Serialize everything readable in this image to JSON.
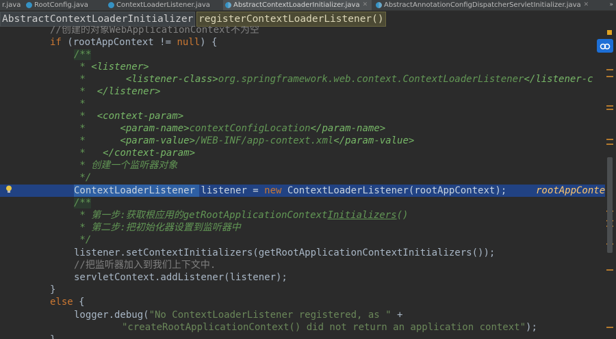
{
  "tabs": [
    {
      "label": "r.java",
      "icon": "none",
      "active": false
    },
    {
      "label": "RootConfig.java",
      "icon": "java-class-icon",
      "active": false
    },
    {
      "label": "ContextLoaderListener.java",
      "icon": "java-class-icon",
      "active": false
    },
    {
      "label": "AbstractContextLoaderInitializer.java",
      "icon": "abstract-class-icon",
      "active": true
    },
    {
      "label": "AbstractAnnotationConfigDispatcherServletInitializer.java",
      "icon": "abstract-class-icon",
      "active": false
    }
  ],
  "tab_menu_label": "»",
  "breadcrumb": {
    "class_name": "AbstractContextLoaderInitializer",
    "method_name": "registerContextLoaderListener()"
  },
  "code": {
    "l0": "//创建的对象WebApplicationContext不为空",
    "l1_kw": "if",
    "l1_a": " (rootAppContext != ",
    "l1_null": "null",
    "l1_b": ") {",
    "l2": "/**",
    "l3_star": " * ",
    "l3_tag": "<listener>",
    "l4_star": " *       ",
    "l4_open": "<listener-class>",
    "l4_val": "org.springframework.web.context.ContextLoaderListener",
    "l4_close": "</listener-c",
    "l5_star": " *  ",
    "l5_tag": "</listener>",
    "l6": " *",
    "l7_star": " *  ",
    "l7_tag": "<context-param>",
    "l8_star": " *      ",
    "l8_open": "<param-name>",
    "l8_val": "contextConfigLocation",
    "l8_close": "</param-name>",
    "l9_star": " *      ",
    "l9_open": "<param-value>",
    "l9_val": "/WEB-INF/app-context.xml",
    "l9_close": "</param-value>",
    "l10_star": " *   ",
    "l10_tag": "</context-param>",
    "l11": " * 创建一个监听器对象",
    "l12": " */",
    "l13_type": "ContextLoaderListener",
    "l13_a": " listener = ",
    "l13_new": "new",
    "l13_b": " ContextLoaderListener(rootAppContext);",
    "l13_hint": "rootAppContex",
    "l14": "/**",
    "l15_a": " * 第一步:获取根应用的getRootApplicationContext",
    "l15_b": "Initializers",
    "l15_c": "()",
    "l16": " * 第二步:把初始化器设置到监听器中",
    "l17": " */",
    "l18": "listener.setContextInitializers(getRootApplicationContextInitializers());",
    "l19": "//把监听器加入到我们上下文中.",
    "l20": "servletContext.addListener(listener);",
    "l21": "}",
    "l22_kw": "else",
    "l22_b": " {",
    "l23_a": "logger.debug(",
    "l23_str": "\"No ContextLoaderListener registered, as \"",
    "l23_b": " +",
    "l24_str": "\"createRootApplicationContext() did not return an application context\"",
    "l24_b": ");",
    "l25": "}"
  },
  "colors": {
    "background": "#2b2b2b",
    "keyword": "#cc7832",
    "doc_comment": "#629755",
    "string": "#6a8759",
    "line_comment": "#808080",
    "highlight_line": "#214283",
    "warning_mark": "#b57a2d"
  }
}
